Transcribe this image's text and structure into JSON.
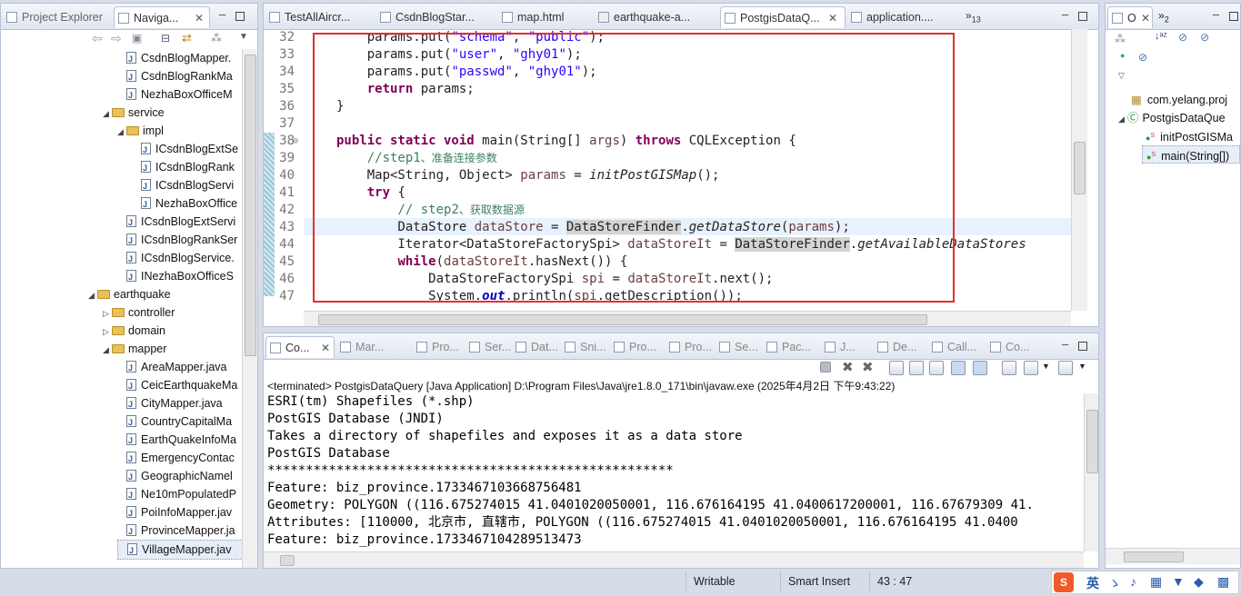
{
  "left_panel": {
    "tabs": [
      "Project Explorer",
      "Naviga..."
    ],
    "tree": [
      {
        "label": "CsdnBlogMapper.",
        "type": "java",
        "indent": 2
      },
      {
        "label": "CsdnBlogRankMa",
        "type": "java",
        "indent": 2
      },
      {
        "label": "NezhaBoxOfficeM",
        "type": "java",
        "indent": 2
      },
      {
        "label": "service",
        "type": "folder",
        "indent": 1,
        "expanded": true
      },
      {
        "label": "impl",
        "type": "folder",
        "indent": 2,
        "expanded": true
      },
      {
        "label": "ICsdnBlogExtSe",
        "type": "java",
        "indent": 3
      },
      {
        "label": "ICsdnBlogRank",
        "type": "java",
        "indent": 3
      },
      {
        "label": "ICsdnBlogServi",
        "type": "java",
        "indent": 3
      },
      {
        "label": "NezhaBoxOffice",
        "type": "java",
        "indent": 3
      },
      {
        "label": "ICsdnBlogExtServi",
        "type": "java",
        "indent": 2
      },
      {
        "label": "ICsdnBlogRankSer",
        "type": "java",
        "indent": 2
      },
      {
        "label": "ICsdnBlogService.",
        "type": "java",
        "indent": 2
      },
      {
        "label": "INezhaBoxOfficeS",
        "type": "java",
        "indent": 2
      },
      {
        "label": "earthquake",
        "type": "folder",
        "indent": 0,
        "expanded": true
      },
      {
        "label": "controller",
        "type": "folder",
        "indent": 1,
        "expanded": false
      },
      {
        "label": "domain",
        "type": "folder",
        "indent": 1,
        "expanded": false
      },
      {
        "label": "mapper",
        "type": "folder",
        "indent": 1,
        "expanded": true
      },
      {
        "label": "AreaMapper.java",
        "type": "java",
        "indent": 2
      },
      {
        "label": "CeicEarthquakeMa",
        "type": "java",
        "indent": 2
      },
      {
        "label": "CityMapper.java",
        "type": "java",
        "indent": 2
      },
      {
        "label": "CountryCapitalMa",
        "type": "java",
        "indent": 2
      },
      {
        "label": "EarthQuakeInfoMa",
        "type": "java",
        "indent": 2
      },
      {
        "label": "EmergencyContac",
        "type": "java",
        "indent": 2
      },
      {
        "label": "GeographicNamel",
        "type": "java",
        "indent": 2
      },
      {
        "label": "Ne10mPopulatedP",
        "type": "java",
        "indent": 2
      },
      {
        "label": "PoiInfoMapper.jav",
        "type": "java",
        "indent": 2
      },
      {
        "label": "ProvinceMapper.ja",
        "type": "java",
        "indent": 2
      },
      {
        "label": "VillageMapper.jav",
        "type": "java",
        "indent": 2
      }
    ]
  },
  "editor": {
    "tabs": [
      "TestAllAircr...",
      "CsdnBlogStar...",
      "map.html",
      "earthquake-a...",
      "PostgisDataQ...",
      "application...."
    ],
    "overflow_count": "13",
    "lines": [
      {
        "n": "32",
        "t": "        params.put(\"schema\", \"public\");"
      },
      {
        "n": "33",
        "t": "        params.put(\"user\", \"ghy01\");"
      },
      {
        "n": "34",
        "t": "        params.put(\"passwd\", \"ghy01\");"
      },
      {
        "n": "35",
        "t": "        return params;"
      },
      {
        "n": "36",
        "t": "    }"
      },
      {
        "n": "37",
        "t": ""
      },
      {
        "n": "38",
        "t": "    public static void main(String[] args) throws CQLException {"
      },
      {
        "n": "39",
        "t": "        //step1、准备连接参数"
      },
      {
        "n": "40",
        "t": "        Map<String, Object> params = initPostGISMap();"
      },
      {
        "n": "41",
        "t": "        try {"
      },
      {
        "n": "42",
        "t": "            // step2、获取数据源"
      },
      {
        "n": "43",
        "t": "            DataStore dataStore = DataStoreFinder.getDataStore(params);"
      },
      {
        "n": "44",
        "t": "            Iterator<DataStoreFactorySpi> dataStoreIt = DataStoreFinder.getAvailableDataStores"
      },
      {
        "n": "45",
        "t": "            while(dataStoreIt.hasNext()) {"
      },
      {
        "n": "46",
        "t": "                DataStoreFactorySpi spi = dataStoreIt.next();"
      },
      {
        "n": "47",
        "t": "                System.out.println(spi.getDescription());"
      }
    ]
  },
  "outline": {
    "tabs": [
      "O",
      "2"
    ],
    "items": [
      {
        "label": "com.yelang.proj"
      },
      {
        "label": "PostgisDataQue"
      },
      {
        "label": "initPostGISMa"
      },
      {
        "label": "main(String[])"
      }
    ]
  },
  "console": {
    "tabs": [
      "Co...",
      "Mar...",
      "Pro...",
      "Ser...",
      "Dat...",
      "Sni...",
      "Pro...",
      "Pro...",
      "Se...",
      "Pac...",
      "J...",
      "De...",
      "Call...",
      "Co..."
    ],
    "header": "<terminated> PostgisDataQuery [Java Application] D:\\Program Files\\Java\\jre1.8.0_171\\bin\\javaw.exe (2025年4月2日 下午9:43:22)",
    "lines": [
      "ESRI(tm) Shapefiles (*.shp)",
      "PostGIS Database (JNDI)",
      "Takes a directory of shapefiles and exposes it as a data store",
      "PostGIS Database",
      "*****************************************************",
      "Feature: biz_province.1733467103668756481",
      "Geometry: POLYGON ((116.675274015 41.0401020050001, 116.676164195 41.0400617200001, 116.67679309 41.",
      "Attributes: [110000, 北京市, 直辖市, POLYGON ((116.675274015 41.0401020050001, 116.676164195 41.0400",
      "Feature: biz_province.1733467104289513473"
    ]
  },
  "status_bar": {
    "writable": "Writable",
    "insert_mode": "Smart Insert",
    "position": "43 : 47",
    "ime_label": "英"
  }
}
